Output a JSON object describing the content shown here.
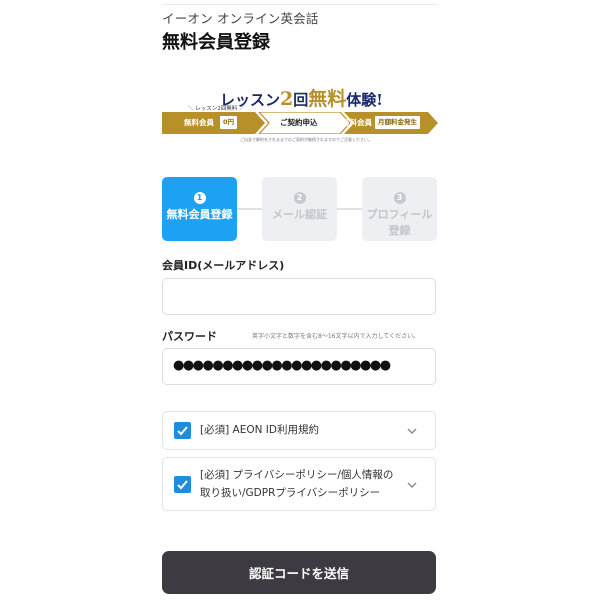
{
  "header": {
    "app_title": "イーオン オンライン英会話",
    "page_title": "無料会員登録"
  },
  "banner": {
    "headline_part1": "レッスン",
    "headline_num": "2",
    "headline_part2": "回",
    "headline_free": "無料",
    "headline_part3": "体験!",
    "sub_caption": "レッスン2回無料",
    "flow": {
      "step1_label": "無料会員",
      "step1_value": "0円",
      "step2_label": "ご契約申込",
      "step3_label": "有料会員",
      "step3_value": "月額料金発生"
    },
    "note": "ご自身で解約をされるまでのご契約が継続されますのでご注意ください。"
  },
  "steps": [
    {
      "number": "1",
      "label": "無料会員登録",
      "active": true
    },
    {
      "number": "2",
      "label": "メール認証",
      "active": false
    },
    {
      "number": "3",
      "label": "プロフィール登録",
      "active": false
    }
  ],
  "form": {
    "member_id_label": "会員ID(メールアドレス)",
    "member_id_value": "",
    "password_label": "パスワード",
    "password_hint": "英字小文字と数字を含む8〜16文字以内で入力してください。",
    "password_masked": "●●●●●●●●●●●●●●●●●●●●●●"
  },
  "agreements": [
    {
      "text": "[必須] AEON ID利用規約",
      "checked": true
    },
    {
      "text_line1": "[必須] プライバシーポリシー/個人情報の",
      "text_line2": "取り扱い/GDPRプライバシーポリシー",
      "checked": true
    }
  ],
  "submit_label": "認証コードを送信",
  "colors": {
    "step_active": "#1da1f2",
    "step_inactive": "#eeeff2",
    "checkbox": "#1d8ddd",
    "submit_bg": "#3d3b41",
    "banner_gold": "#b8902a",
    "banner_navy": "#1b2a6b"
  }
}
